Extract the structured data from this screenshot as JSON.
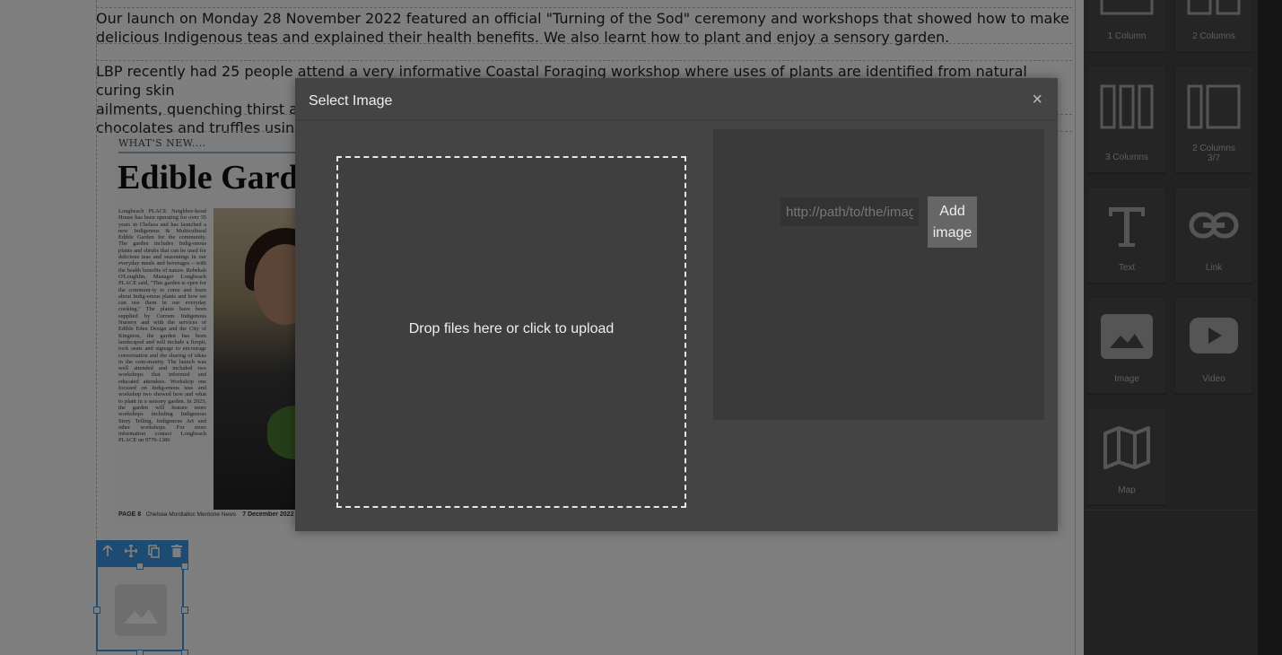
{
  "canvas": {
    "paragraph1": "Our launch on Monday 28 November 2022 featured an official \"Turning of the Sod\" ceremony and workshops that showed how to make delicious Indigenous teas and explained their health benefits. We also learnt how to plant and enjoy a sensory garden.",
    "paragraph2_line1": "LBP recently had 25 people attend a very informative Coastal Foraging workshop where uses of plants are identified from natural curing skin",
    "paragraph2_line2": "ailments, quenching thirst an",
    "paragraph2_line3": "chocolates and truffles using",
    "clipping": {
      "kicker": "WHAT'S NEW....",
      "headline": "Edible Garden",
      "body": "Longbeach PLACE Neighbor-hood House has been operating for over 35 years in Chelsea and has launched a new Indigenous & Multicultural Edible Garden for the community. The garden includes Indig-enous plants and shrubs that can be used for delicious teas and seasonings in our everyday meals and beverages – with the health benefits of nature. Rebekah O'Loughlin, Manager Longbeach PLACE said, \"This garden is open for the communi-ty to come and learn about Indig-enous plants and how we can use them in our everyday cooking.\" The plants have been supplied by Currum Indigenous Nursery and with the services of Edible Eden Design and the City of Kingston, the garden has been landscaped and will include a firepit, rock seats and signage to encourage conversation and the sharing of ideas in the com-munity. The launch was well attended and included two workshops that informed and educated attendees. Workshop one focused on Indig-enous teas and workshop two showed how and what to plant in a sensory garden. In 2023, the garden will feature more workshops including Indigenous Story Telling, Indigenous Art and other workshops. For more information contact Longbeach PLACE on 9776-1386",
      "footer_page": "PAGE 8",
      "footer_paper": "Chelsea Mordialloc Mentone News",
      "footer_date": "7 December 2022"
    },
    "toolbar_icons": [
      "arrow-up-icon",
      "move-icon",
      "copy-icon",
      "delete-icon"
    ]
  },
  "modal": {
    "title": "Select Image",
    "close": "×",
    "dropzone_text": "Drop files here or click to upload",
    "url_placeholder": "http://path/to/the/image.jpg",
    "add_button": "Add image"
  },
  "blocks": [
    {
      "id": "1col",
      "label": "1 Column"
    },
    {
      "id": "2col",
      "label": "2 Columns"
    },
    {
      "id": "3col",
      "label": "3 Columns"
    },
    {
      "id": "2col37",
      "label": "2 Columns 3/7"
    },
    {
      "id": "text",
      "label": "Text"
    },
    {
      "id": "link",
      "label": "Link"
    },
    {
      "id": "image",
      "label": "Image"
    },
    {
      "id": "video",
      "label": "Video"
    },
    {
      "id": "map",
      "label": "Map"
    }
  ],
  "colors": {
    "selection": "#3b97e3",
    "panel": "#444444",
    "modal": "#444444"
  }
}
